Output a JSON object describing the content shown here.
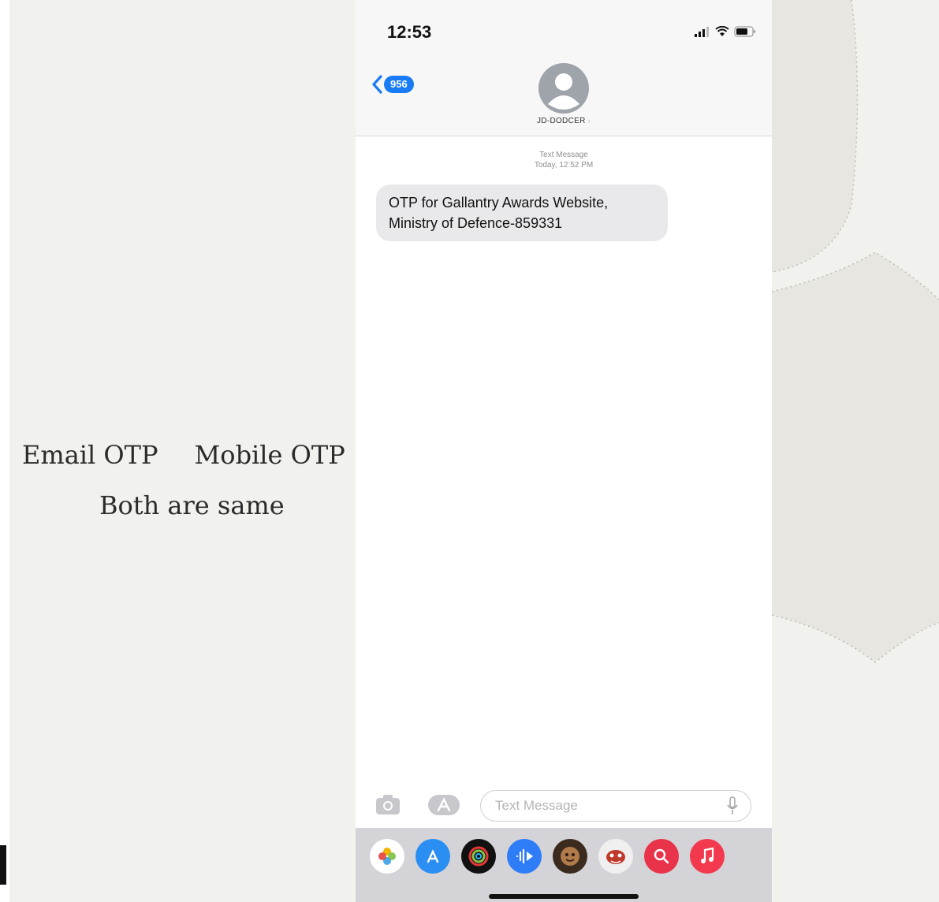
{
  "slide": {
    "caption_email": "Email OTP",
    "caption_mobile": "Mobile OTP",
    "caption_same": "Both are same"
  },
  "phone": {
    "status": {
      "time": "12:53"
    },
    "nav": {
      "back_count": "956",
      "contact_name": "JD-DODCER"
    },
    "thread": {
      "meta_line1": "Text Message",
      "meta_line2": "Today, 12:52 PM",
      "messages": [
        {
          "text_line1": "OTP for Gallantry Awards Website,",
          "text_line2": "Ministry of Defence-859331"
        }
      ]
    },
    "composer": {
      "placeholder": "Text Message"
    },
    "app_drawer": {
      "apps": [
        "photos-icon",
        "app-store-icon",
        "activity-icon",
        "audio-icon",
        "memoji-icon",
        "animoji-icon",
        "search-images-icon",
        "music-icon"
      ]
    }
  },
  "colors": {
    "accent": "#1a7cf5",
    "bubble": "#e9e9eb",
    "slide_bg": "#f1f1ee",
    "decor": "#e6e5e0"
  }
}
